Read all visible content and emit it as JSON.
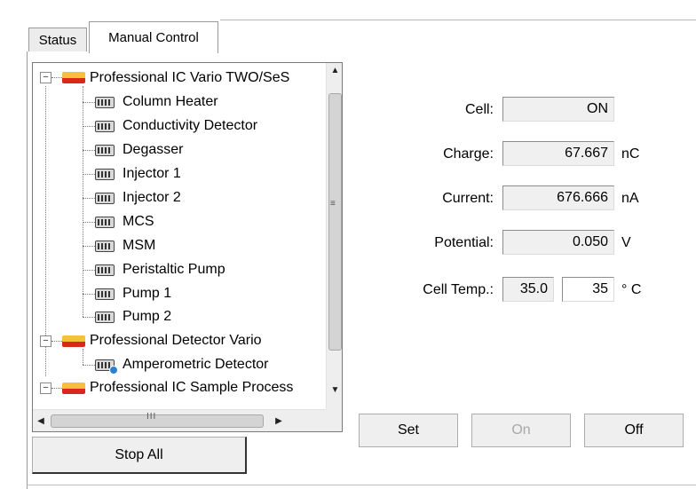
{
  "tabs": {
    "status": "Status",
    "manual_control": "Manual Control"
  },
  "tree": {
    "root1": "Professional IC Vario TWO/SeS",
    "root1_children": [
      "Column Heater",
      "Conductivity Detector",
      "Degasser",
      "Injector 1",
      "Injector 2",
      "MCS",
      "MSM",
      "Peristaltic Pump",
      "Pump 1",
      "Pump 2"
    ],
    "root2": "Professional Detector Vario",
    "root2_children": [
      "Amperometric Detector"
    ],
    "root3": "Professional IC Sample Process"
  },
  "scrollbar": {
    "v_grip": "≡",
    "h_grip": "III"
  },
  "readouts": {
    "cell_label": "Cell:",
    "cell_value": "ON",
    "charge_label": "Charge:",
    "charge_value": "67.667",
    "charge_unit": "nC",
    "current_label": "Current:",
    "current_value": "676.666",
    "current_unit": "nA",
    "potential_label": "Potential:",
    "potential_value": "0.050",
    "potential_unit": "V",
    "celltemp_label": "Cell Temp.:",
    "celltemp_actual": "35.0",
    "celltemp_setpoint": "35",
    "celltemp_unit": "° C"
  },
  "buttons": {
    "set": "Set",
    "on": "On",
    "off": "Off",
    "stop_all": "Stop All"
  },
  "colors": {
    "folder_top": "#f6c03a",
    "folder_bottom": "#d7281b",
    "badge": "#2a7fd6",
    "disabled_text": "#a8a8a8"
  }
}
